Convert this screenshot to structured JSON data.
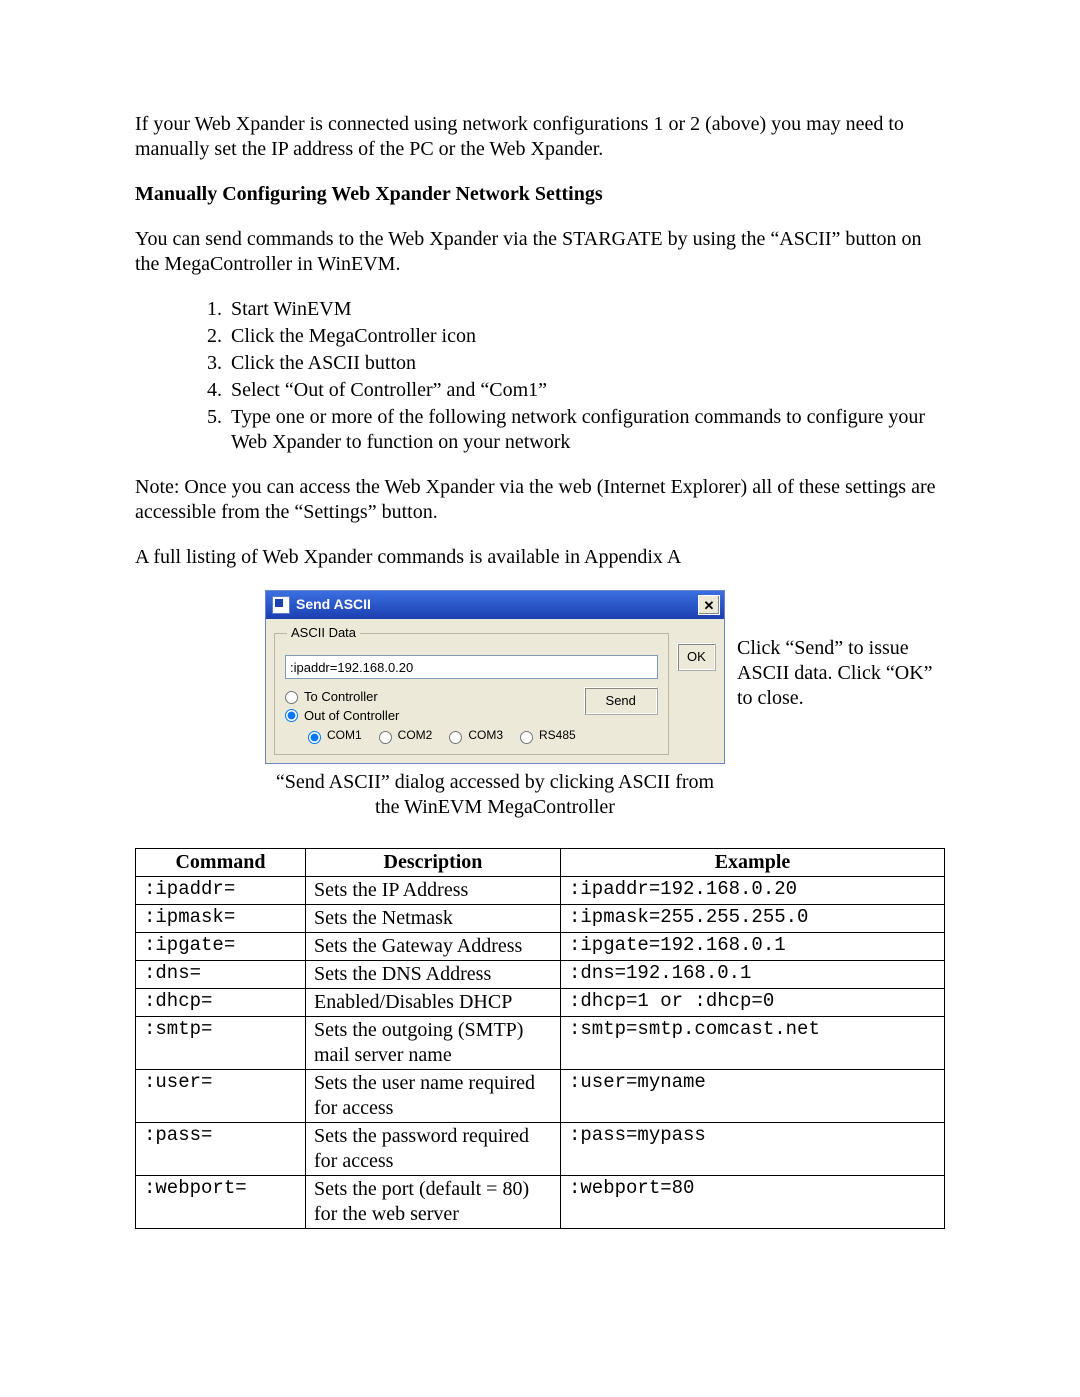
{
  "intro": "If your Web Xpander is connected using network configurations 1 or 2 (above) you may need to manually set the IP address of the PC or the Web Xpander.",
  "heading": "Manually Configuring Web Xpander Network Settings",
  "intro2": "You can send commands to the Web Xpander via the STARGATE by using the “ASCII” button on the MegaController in WinEVM.",
  "steps": [
    "Start WinEVM",
    "Click the MegaController icon",
    "Click the ASCII button",
    "Select “Out of Controller” and “Com1”",
    "Type one or more of the following network configuration commands to configure your Web Xpander to function on your network"
  ],
  "note": "Note: Once you can access the Web Xpander via the web (Internet Explorer) all of these settings are accessible from the “Settings” button.",
  "appendix": "A full listing of Web Xpander commands is available in Appendix A",
  "dialog": {
    "title": "Send ASCII",
    "close_label": "✕",
    "group_label": "ASCII Data",
    "input_value": ":ipaddr=192.168.0.20",
    "radio_to": "To Controller",
    "radio_out": "Out of Controller",
    "ports": [
      "COM1",
      "COM2",
      "COM3",
      "RS485"
    ],
    "send_label": "Send",
    "ok_label": "OK"
  },
  "side_note": "Click “Send” to issue ASCII data. Click “OK” to close.",
  "caption": "“Send ASCII” dialog accessed by clicking ASCII from the WinEVM MegaController",
  "table": {
    "headers": [
      "Command",
      "Description",
      "Example"
    ],
    "rows": [
      {
        "cmd": ":ipaddr=",
        "desc": "Sets the IP Address",
        "ex": ":ipaddr=192.168.0.20"
      },
      {
        "cmd": ":ipmask=",
        "desc": "Sets the Netmask",
        "ex": ":ipmask=255.255.255.0"
      },
      {
        "cmd": ":ipgate=",
        "desc": "Sets the Gateway Address",
        "ex": ":ipgate=192.168.0.1"
      },
      {
        "cmd": ":dns=",
        "desc": "Sets the DNS Address",
        "ex": ":dns=192.168.0.1"
      },
      {
        "cmd": ":dhcp=",
        "desc": "Enabled/Disables DHCP",
        "ex": ":dhcp=1  or  :dhcp=0"
      },
      {
        "cmd": ":smtp=",
        "desc": "Sets the outgoing (SMTP) mail server name",
        "ex": ":smtp=smtp.comcast.net"
      },
      {
        "cmd": ":user=",
        "desc": "Sets the user name required for access",
        "ex": ":user=myname"
      },
      {
        "cmd": ":pass=",
        "desc": "Sets the password required for access",
        "ex": ":pass=mypass"
      },
      {
        "cmd": ":webport=",
        "desc": "Sets the port (default = 80) for the web server",
        "ex": ":webport=80"
      }
    ]
  }
}
